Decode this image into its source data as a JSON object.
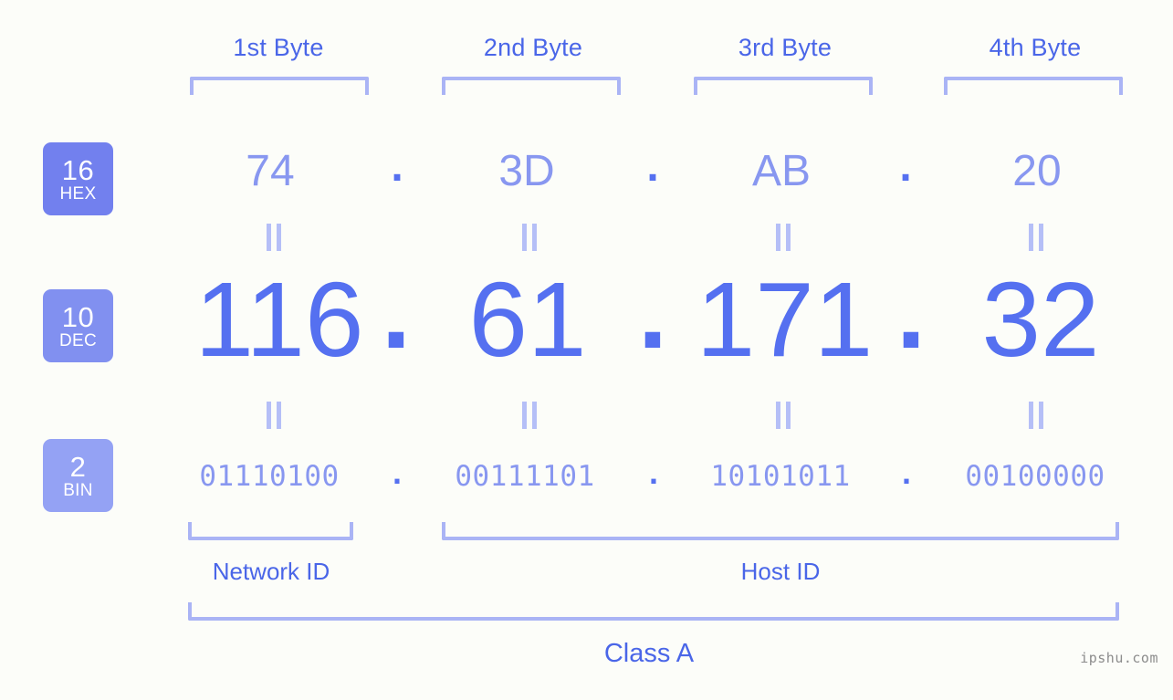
{
  "headers": [
    {
      "label": "1st Byte"
    },
    {
      "label": "2nd Byte"
    },
    {
      "label": "3rd Byte"
    },
    {
      "label": "4th Byte"
    }
  ],
  "rows": {
    "hex": {
      "badge_number": "16",
      "badge_name": "HEX",
      "values": [
        "74",
        "3D",
        "AB",
        "20"
      ],
      "separator": "."
    },
    "dec": {
      "badge_number": "10",
      "badge_name": "DEC",
      "values": [
        "116",
        "61",
        "171",
        "32"
      ],
      "separator": "."
    },
    "bin": {
      "badge_number": "2",
      "badge_name": "BIN",
      "values": [
        "01110100",
        "00111101",
        "10101011",
        "00100000"
      ],
      "separator": "."
    }
  },
  "equals_symbol": "=",
  "regions": [
    {
      "label": "Network ID"
    },
    {
      "label": "Host ID"
    }
  ],
  "class": {
    "label": "Class A"
  },
  "watermark": {
    "text": "ipshu.com"
  },
  "colors": {
    "background": "#fcfdf9",
    "accent_strong": "#4a66e8",
    "accent_dec": "#5570f0",
    "accent_light": "#8897f0",
    "bracket": "#aab4f5",
    "badge_hex": "#7280ee",
    "badge_dec": "#8190f0",
    "badge_bin": "#94a2f4",
    "watermark": "#8c8c8c"
  },
  "address": {
    "hex": "74.3D.AB.20",
    "dec": "116.61.171.32",
    "bin": "01110100.00111101.10101011.00100000"
  }
}
